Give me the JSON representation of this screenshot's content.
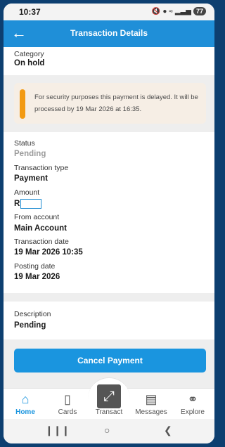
{
  "status_bar": {
    "time": "10:37",
    "battery": "77",
    "icons": [
      "mute-icon",
      "location-icon",
      "wifi-icon",
      "signal-icon",
      "battery-icon"
    ]
  },
  "header": {
    "title": "Transaction Details",
    "back_icon": "back-arrow-icon"
  },
  "category": {
    "label": "Category",
    "value": "On hold"
  },
  "notice": {
    "text": "For security purposes this payment is delayed. It will be processed by 19 Mar 2026 at 16:35.",
    "accent_color": "#f29a13"
  },
  "details": {
    "status_label": "Status",
    "status_value": "Pending",
    "type_label": "Transaction type",
    "type_value": "Payment",
    "amount_label": "Amount",
    "amount_prefix": "R",
    "from_label": "From account",
    "from_value": "Main Account",
    "date_label": "Transaction date",
    "date_value": "19 Mar 2026 10:35",
    "posting_label": "Posting date",
    "posting_value": "19 Mar 2026"
  },
  "description": {
    "label": "Description",
    "value": "Pending"
  },
  "actions": {
    "cancel_label": "Cancel Payment"
  },
  "bottom_nav": {
    "items": [
      {
        "label": "Home",
        "icon": "home-icon",
        "active": true
      },
      {
        "label": "Cards",
        "icon": "card-icon",
        "active": false
      },
      {
        "label": "Transact",
        "icon": "transact-icon",
        "active": false
      },
      {
        "label": "Messages",
        "icon": "messages-icon",
        "active": false
      },
      {
        "label": "Explore",
        "icon": "binoculars-icon",
        "active": false
      }
    ]
  },
  "colors": {
    "primary": "#1a95df",
    "frame": "#0d3f70",
    "warning": "#f29a13"
  }
}
